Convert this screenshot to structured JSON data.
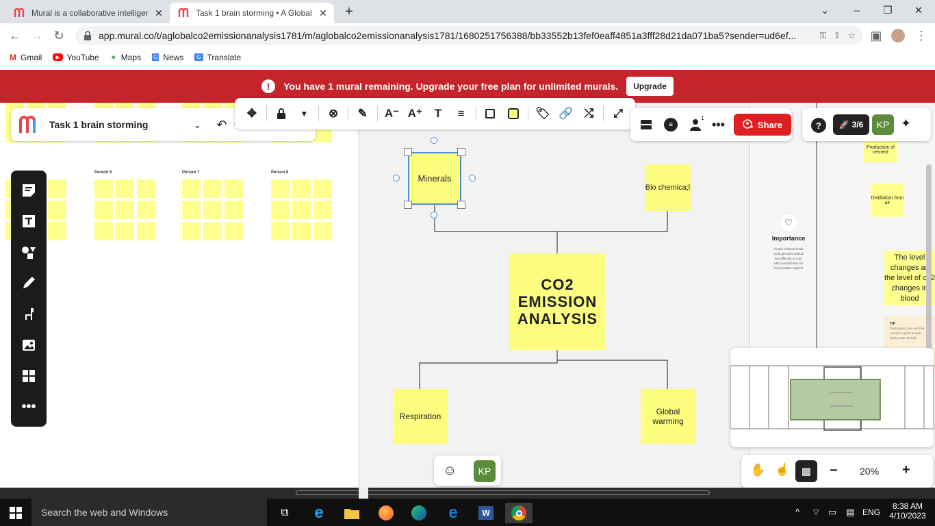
{
  "browser": {
    "tabs": [
      {
        "title": "Mural is a collaborative intelligen"
      },
      {
        "title": "Task 1 brain storming • A Global"
      }
    ],
    "url": "app.mural.co/t/aglobalco2emissionanalysis1781/m/aglobalco2emissionanalysis1781/1680251756388/bb33552b13fef0eaff4851a3fff28d21da071ba5?sender=ud6ef...",
    "bookmarks": [
      "Gmail",
      "YouTube",
      "Maps",
      "News",
      "Translate"
    ]
  },
  "banner": {
    "message": "You have 1 mural remaining. Upgrade your free plan for unlimited murals.",
    "upgrade_label": "Upgrade"
  },
  "mural": {
    "title": "Task 1 brain storming",
    "share_label": "Share",
    "progress": "3/6",
    "user_initials": "KP",
    "notification_count": "1",
    "zoom": "20%"
  },
  "board": {
    "person_labels": [
      "Person 6",
      "Person 7",
      "Person 8"
    ],
    "minerals": "Minerals",
    "biochemical": "Bio chemica;l",
    "center": "CO2 EMISSION ANALYSIS",
    "respiration": "Respiration",
    "global_warming": "Global warming"
  },
  "right_pane": {
    "production": "Production of cement",
    "distillation": "Distillation from air",
    "importance_title": "Importance",
    "importance_text": "If each of these break could get done without any difficulty or cost, which would have the most positive impact?",
    "level_note": "The level changes as the level of co2 changes in blood",
    "tip_title": "TIP",
    "tip_text": "Participants can use their cursors to point at and... sticky notes should..."
  },
  "taskbar": {
    "search_placeholder": "Search the web and Windows",
    "language": "ENG",
    "time": "8:38 AM",
    "date": "4/10/2023"
  },
  "colors": {
    "sticky": "#fdfd80",
    "banner": "#c5242b",
    "share": "#e02020",
    "avatar": "#5a8c3c"
  }
}
